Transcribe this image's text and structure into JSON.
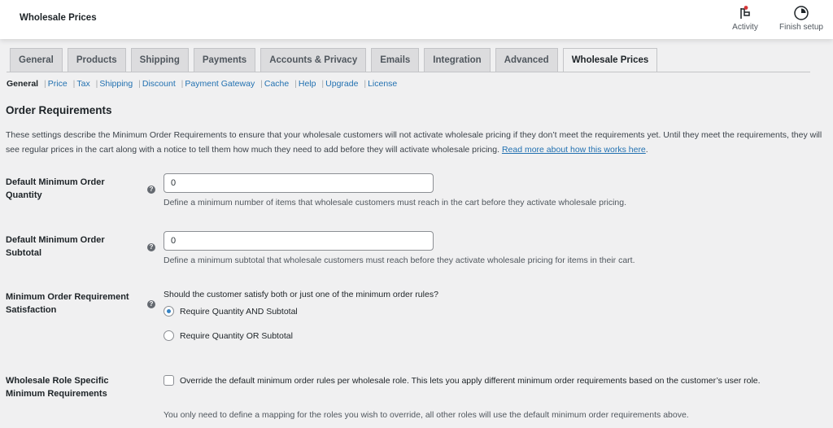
{
  "header": {
    "title": "Wholesale Prices",
    "activity_label": "Activity",
    "finish_setup_label": "Finish setup"
  },
  "tabs": [
    {
      "label": "General",
      "active": false
    },
    {
      "label": "Products",
      "active": false
    },
    {
      "label": "Shipping",
      "active": false
    },
    {
      "label": "Payments",
      "active": false
    },
    {
      "label": "Accounts & Privacy",
      "active": false
    },
    {
      "label": "Emails",
      "active": false
    },
    {
      "label": "Integration",
      "active": false
    },
    {
      "label": "Advanced",
      "active": false
    },
    {
      "label": "Wholesale Prices",
      "active": true
    }
  ],
  "subnav": {
    "current": "General",
    "links": [
      "Price",
      "Tax",
      "Shipping",
      "Discount",
      "Payment Gateway",
      "Cache",
      "Help",
      "Upgrade",
      "License"
    ],
    "separator": "|"
  },
  "section": {
    "title": "Order Requirements",
    "intro": "These settings describe the Minimum Order Requirements to ensure that your wholesale customers will not activate wholesale pricing if they don’t meet the requirements yet. Until they meet the requirements, they will see regular prices in the cart along with a notice to tell them how much they need to add before they will activate wholesale pricing.",
    "intro_link": "Read more about how this works here",
    "intro_end": "."
  },
  "fields": {
    "min_qty": {
      "label_line1": "Default Minimum Order",
      "label_line2": "Quantity",
      "value": "0",
      "description": "Define a minimum number of items that wholesale customers must reach in the cart before they activate wholesale pricing."
    },
    "min_subtotal": {
      "label_line1": "Default Minimum Order",
      "label_line2": "Subtotal",
      "value": "0",
      "description": "Define a minimum subtotal that wholesale customers must reach before they activate wholesale pricing for items in their cart."
    },
    "satisfaction": {
      "label_line1": "Minimum Order Requirement",
      "label_line2": "Satisfaction",
      "question": "Should the customer satisfy both or just one of the minimum order rules?",
      "options": [
        {
          "label": "Require Quantity AND Subtotal",
          "checked": true
        },
        {
          "label": "Require Quantity OR Subtotal",
          "checked": false
        }
      ]
    },
    "role_specific": {
      "label_line1": "Wholesale Role Specific",
      "label_line2": "Minimum Requirements",
      "checked": false,
      "checkbox_text": "Override the default minimum order rules per wholesale role. This lets you apply different minimum order requirements based on the customer’s user role.",
      "note": "You only need to define a mapping for the roles you wish to override, all other roles will use the default minimum order requirements above."
    }
  },
  "icons": {
    "help": "?"
  },
  "colors": {
    "link": "#2271b1",
    "radio_checked": "#3582c4",
    "activity_dot": "#d63638"
  }
}
